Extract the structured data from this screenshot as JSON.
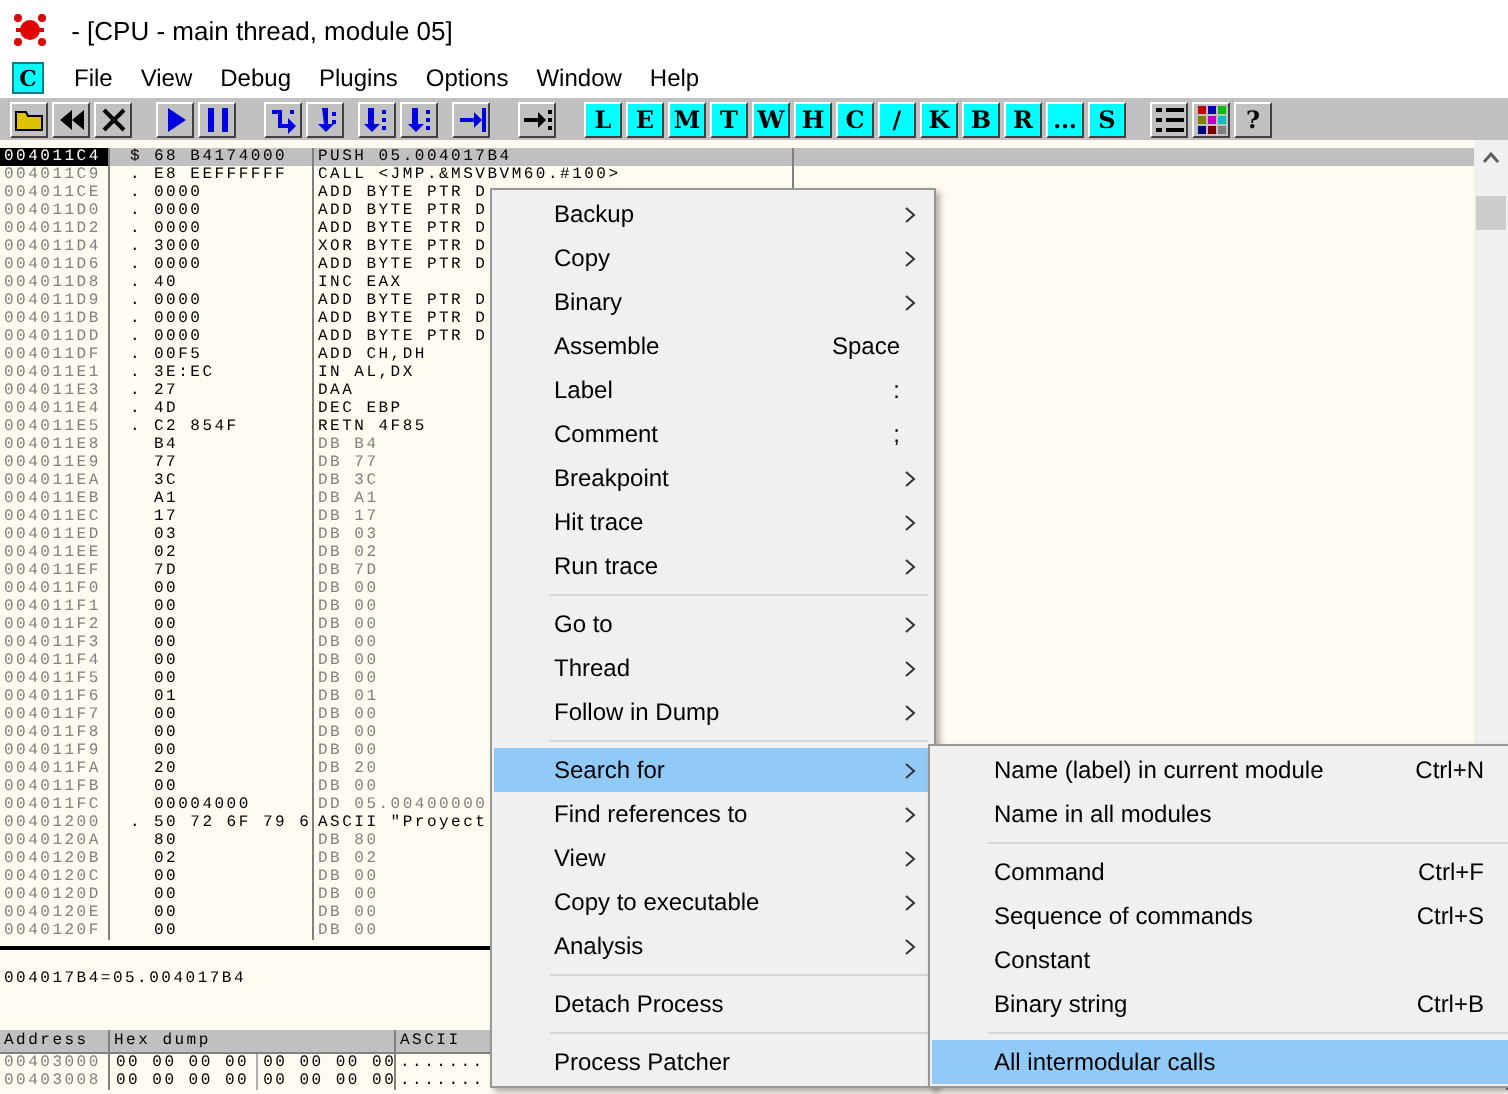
{
  "window": {
    "title": " - [CPU - main thread, module 05]"
  },
  "menu_bar": {
    "badge": "C",
    "items": [
      "File",
      "View",
      "Debug",
      "Plugins",
      "Options",
      "Window",
      "Help"
    ]
  },
  "toolbar": {
    "letter_buttons": [
      "L",
      "E",
      "M",
      "T",
      "W",
      "H",
      "C",
      "/",
      "K",
      "B",
      "R",
      "…",
      "S"
    ],
    "help_button": "?"
  },
  "disassembly": {
    "rows": [
      {
        "address": "004011C4",
        "marker": "$",
        "hex": "68 B4174000",
        "instruction": "PUSH 05.004017B4",
        "kind": "code",
        "selected": true
      },
      {
        "address": "004011C9",
        "marker": ".",
        "hex": "E8 EEFFFFFF",
        "instruction": "CALL <JMP.&MSVBVM60.#100>",
        "kind": "code",
        "selected": false
      },
      {
        "address": "004011CE",
        "marker": ".",
        "hex": "0000",
        "instruction": "ADD BYTE PTR D",
        "kind": "code",
        "selected": false
      },
      {
        "address": "004011D0",
        "marker": ".",
        "hex": "0000",
        "instruction": "ADD BYTE PTR D",
        "kind": "code",
        "selected": false
      },
      {
        "address": "004011D2",
        "marker": ".",
        "hex": "0000",
        "instruction": "ADD BYTE PTR D",
        "kind": "code",
        "selected": false
      },
      {
        "address": "004011D4",
        "marker": ".",
        "hex": "3000",
        "instruction": "XOR BYTE PTR D",
        "kind": "code",
        "selected": false
      },
      {
        "address": "004011D6",
        "marker": ".",
        "hex": "0000",
        "instruction": "ADD BYTE PTR D",
        "kind": "code",
        "selected": false
      },
      {
        "address": "004011D8",
        "marker": ".",
        "hex": "40",
        "instruction": "INC EAX",
        "kind": "code",
        "selected": false
      },
      {
        "address": "004011D9",
        "marker": ".",
        "hex": "0000",
        "instruction": "ADD BYTE PTR D",
        "kind": "code",
        "selected": false
      },
      {
        "address": "004011DB",
        "marker": ".",
        "hex": "0000",
        "instruction": "ADD BYTE PTR D",
        "kind": "code",
        "selected": false
      },
      {
        "address": "004011DD",
        "marker": ".",
        "hex": "0000",
        "instruction": "ADD BYTE PTR D",
        "kind": "code",
        "selected": false
      },
      {
        "address": "004011DF",
        "marker": ".",
        "hex": "00F5",
        "instruction": "ADD CH,DH",
        "kind": "code",
        "selected": false
      },
      {
        "address": "004011E1",
        "marker": ".",
        "hex": "3E:EC",
        "instruction": "IN AL,DX",
        "kind": "code",
        "selected": false
      },
      {
        "address": "004011E3",
        "marker": ".",
        "hex": "27",
        "instruction": "DAA",
        "kind": "code",
        "selected": false
      },
      {
        "address": "004011E4",
        "marker": ".",
        "hex": "4D",
        "instruction": "DEC EBP",
        "kind": "code",
        "selected": false
      },
      {
        "address": "004011E5",
        "marker": ".",
        "hex": "C2 854F",
        "instruction": "RETN 4F85",
        "kind": "code",
        "selected": false
      },
      {
        "address": "004011E8",
        "hex": "B4",
        "instruction": "DB B4",
        "kind": "data",
        "selected": false
      },
      {
        "address": "004011E9",
        "hex": "77",
        "instruction": "DB 77",
        "kind": "data",
        "selected": false
      },
      {
        "address": "004011EA",
        "hex": "3C",
        "instruction": "DB 3C",
        "kind": "data",
        "selected": false
      },
      {
        "address": "004011EB",
        "hex": "A1",
        "instruction": "DB A1",
        "kind": "data",
        "selected": false
      },
      {
        "address": "004011EC",
        "hex": "17",
        "instruction": "DB 17",
        "kind": "data",
        "selected": false
      },
      {
        "address": "004011ED",
        "hex": "03",
        "instruction": "DB 03",
        "kind": "data",
        "selected": false
      },
      {
        "address": "004011EE",
        "hex": "02",
        "instruction": "DB 02",
        "kind": "data",
        "selected": false
      },
      {
        "address": "004011EF",
        "hex": "7D",
        "instruction": "DB 7D",
        "kind": "data",
        "selected": false
      },
      {
        "address": "004011F0",
        "hex": "00",
        "instruction": "DB 00",
        "kind": "data",
        "selected": false
      },
      {
        "address": "004011F1",
        "hex": "00",
        "instruction": "DB 00",
        "kind": "data",
        "selected": false
      },
      {
        "address": "004011F2",
        "hex": "00",
        "instruction": "DB 00",
        "kind": "data",
        "selected": false
      },
      {
        "address": "004011F3",
        "hex": "00",
        "instruction": "DB 00",
        "kind": "data",
        "selected": false
      },
      {
        "address": "004011F4",
        "hex": "00",
        "instruction": "DB 00",
        "kind": "data",
        "selected": false
      },
      {
        "address": "004011F5",
        "hex": "00",
        "instruction": "DB 00",
        "kind": "data",
        "selected": false
      },
      {
        "address": "004011F6",
        "hex": "01",
        "instruction": "DB 01",
        "kind": "data",
        "selected": false
      },
      {
        "address": "004011F7",
        "hex": "00",
        "instruction": "DB 00",
        "kind": "data",
        "selected": false
      },
      {
        "address": "004011F8",
        "hex": "00",
        "instruction": "DB 00",
        "kind": "data",
        "selected": false
      },
      {
        "address": "004011F9",
        "hex": "00",
        "instruction": "DB 00",
        "kind": "data",
        "selected": false
      },
      {
        "address": "004011FA",
        "hex": "20",
        "instruction": "DB 20",
        "kind": "data",
        "selected": false
      },
      {
        "address": "004011FB",
        "hex": "00",
        "instruction": "DB 00",
        "kind": "data",
        "selected": false
      },
      {
        "address": "004011FC",
        "hex": "00004000",
        "instruction": "DD 05.00400000",
        "kind": "data",
        "selected": false
      },
      {
        "address": "00401200",
        "marker": ".",
        "hex": "50 72 6F 79 6",
        "instruction": "ASCII \"Proyect",
        "kind": "code",
        "selected": false
      },
      {
        "address": "0040120A",
        "hex": "80",
        "instruction": "DB 80",
        "kind": "data",
        "selected": false
      },
      {
        "address": "0040120B",
        "hex": "02",
        "instruction": "DB 02",
        "kind": "data",
        "selected": false
      },
      {
        "address": "0040120C",
        "hex": "00",
        "instruction": "DB 00",
        "kind": "data",
        "selected": false
      },
      {
        "address": "0040120D",
        "hex": "00",
        "instruction": "DB 00",
        "kind": "data",
        "selected": false
      },
      {
        "address": "0040120E",
        "hex": "00",
        "instruction": "DB 00",
        "kind": "data",
        "selected": false
      },
      {
        "address": "0040120F",
        "hex": "00",
        "instruction": "DB 00",
        "kind": "data",
        "selected": false
      }
    ]
  },
  "info_pane": {
    "text": "004017B4=05.004017B4"
  },
  "dump": {
    "columns": [
      "Address",
      "Hex dump",
      "ASCII"
    ],
    "rows": [
      {
        "address": "00403000",
        "hex": [
          "00 00 00 00",
          "00 00 00 00"
        ],
        "ascii": "......."
      },
      {
        "address": "00403008",
        "hex": [
          "00 00 00 00",
          "00 00 00 00"
        ],
        "ascii": "......."
      }
    ]
  },
  "context_menu": {
    "items": [
      {
        "kind": "item",
        "label": "Backup",
        "has_submenu": true,
        "selected": false
      },
      {
        "kind": "item",
        "label": "Copy",
        "has_submenu": true,
        "selected": false
      },
      {
        "kind": "item",
        "label": "Binary",
        "has_submenu": true,
        "selected": false
      },
      {
        "kind": "item",
        "label": "Assemble",
        "shortcut": "Space",
        "has_submenu": false,
        "selected": false
      },
      {
        "kind": "item",
        "label": "Label",
        "shortcut": ":",
        "has_submenu": false,
        "selected": false
      },
      {
        "kind": "item",
        "label": "Comment",
        "shortcut": ";",
        "has_submenu": false,
        "selected": false
      },
      {
        "kind": "item",
        "label": "Breakpoint",
        "has_submenu": true,
        "selected": false
      },
      {
        "kind": "item",
        "label": "Hit trace",
        "has_submenu": true,
        "selected": false
      },
      {
        "kind": "item",
        "label": "Run trace",
        "has_submenu": true,
        "selected": false
      },
      {
        "kind": "separator"
      },
      {
        "kind": "item",
        "label": "Go to",
        "has_submenu": true,
        "selected": false
      },
      {
        "kind": "item",
        "label": "Thread",
        "has_submenu": true,
        "selected": false
      },
      {
        "kind": "item",
        "label": "Follow in Dump",
        "has_submenu": true,
        "selected": false
      },
      {
        "kind": "separator"
      },
      {
        "kind": "item",
        "label": "Search for",
        "has_submenu": true,
        "selected": true
      },
      {
        "kind": "item",
        "label": "Find references to",
        "has_submenu": true,
        "selected": false
      },
      {
        "kind": "item",
        "label": "View",
        "has_submenu": true,
        "selected": false
      },
      {
        "kind": "item",
        "label": "Copy to executable",
        "has_submenu": true,
        "selected": false
      },
      {
        "kind": "item",
        "label": "Analysis",
        "has_submenu": true,
        "selected": false
      },
      {
        "kind": "separator"
      },
      {
        "kind": "item",
        "label": "Detach Process",
        "has_submenu": false,
        "selected": false
      },
      {
        "kind": "separator"
      },
      {
        "kind": "item",
        "label": "Process Patcher",
        "has_submenu": false,
        "selected": false
      }
    ]
  },
  "submenu": {
    "items": [
      {
        "kind": "item",
        "label": "Name (label) in current module",
        "shortcut": "Ctrl+N",
        "selected": false
      },
      {
        "kind": "item",
        "label": "Name in all modules",
        "selected": false
      },
      {
        "kind": "separator"
      },
      {
        "kind": "item",
        "label": "Command",
        "shortcut": "Ctrl+F",
        "selected": false
      },
      {
        "kind": "item",
        "label": "Sequence of commands",
        "shortcut": "Ctrl+S",
        "selected": false
      },
      {
        "kind": "item",
        "label": "Constant",
        "selected": false
      },
      {
        "kind": "item",
        "label": "Binary string",
        "shortcut": "Ctrl+B",
        "selected": false
      },
      {
        "kind": "separator"
      },
      {
        "kind": "item",
        "label": "All intermodular calls",
        "selected": true
      }
    ]
  }
}
